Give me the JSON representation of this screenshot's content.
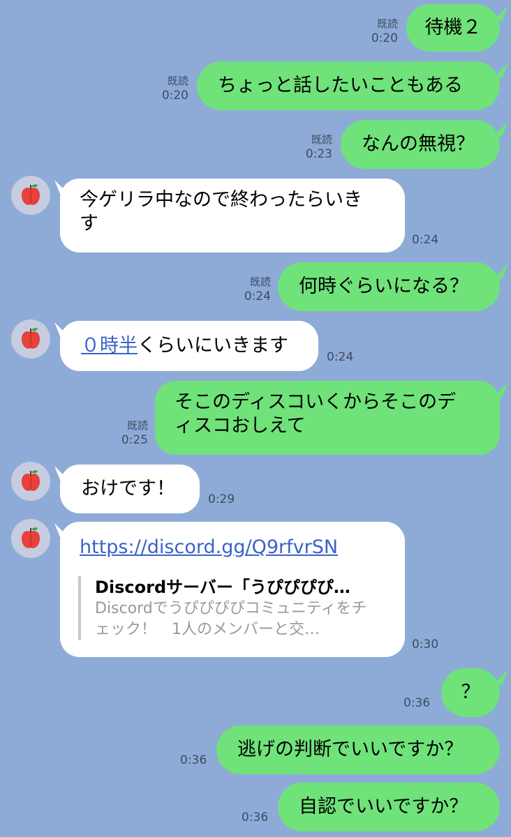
{
  "messages": [
    {
      "id": "m1",
      "sender": "me",
      "text": "待機２",
      "read": "既読",
      "time": "0:20"
    },
    {
      "id": "m2",
      "sender": "me",
      "text": "ちょっと話したいこともある",
      "read": "既読",
      "time": "0:20"
    },
    {
      "id": "m3",
      "sender": "me",
      "text": "なんの無視？",
      "read": "既読",
      "time": "0:23"
    },
    {
      "id": "m4",
      "sender": "them",
      "line1": "今ゲリラ中なので終わったらいき",
      "line2": "す",
      "time": "0:24"
    },
    {
      "id": "m5",
      "sender": "me",
      "text": "何時ぐらいになる？",
      "read": "既読",
      "time": "0:24"
    },
    {
      "id": "m6",
      "sender": "them",
      "link": "０時半",
      "text": "くらいにいきます",
      "time": "0:24"
    },
    {
      "id": "m7",
      "sender": "me",
      "line1": "そこのディスコいくからそこのデ",
      "line2": "ィスコおしえて",
      "read": "既読",
      "time": "0:25"
    },
    {
      "id": "m8",
      "sender": "them",
      "text": "おけです！",
      "time": "0:29"
    },
    {
      "id": "m9",
      "sender": "them",
      "url": "https://discord.gg/Q9rfvrSN",
      "preview_title": "Discordサーバー「うぴぴぴぴ…",
      "preview_desc": "Discordでうぴぴぴぴコミュニティをチェック！　1人のメンバーと交…",
      "time": "0:30"
    },
    {
      "id": "m10",
      "sender": "me",
      "text": "？",
      "time": "0:36"
    },
    {
      "id": "m11",
      "sender": "me",
      "text": "逃げの判断でいいですか？",
      "time": "0:36"
    },
    {
      "id": "m12",
      "sender": "me",
      "text": "自認でいいですか？",
      "time": "0:36"
    }
  ],
  "avatar_icon": "apple-icon",
  "colors": {
    "background": "#8eabd8",
    "my_bubble": "#6fe27a",
    "their_bubble": "#ffffff",
    "link": "#3b62c9"
  }
}
